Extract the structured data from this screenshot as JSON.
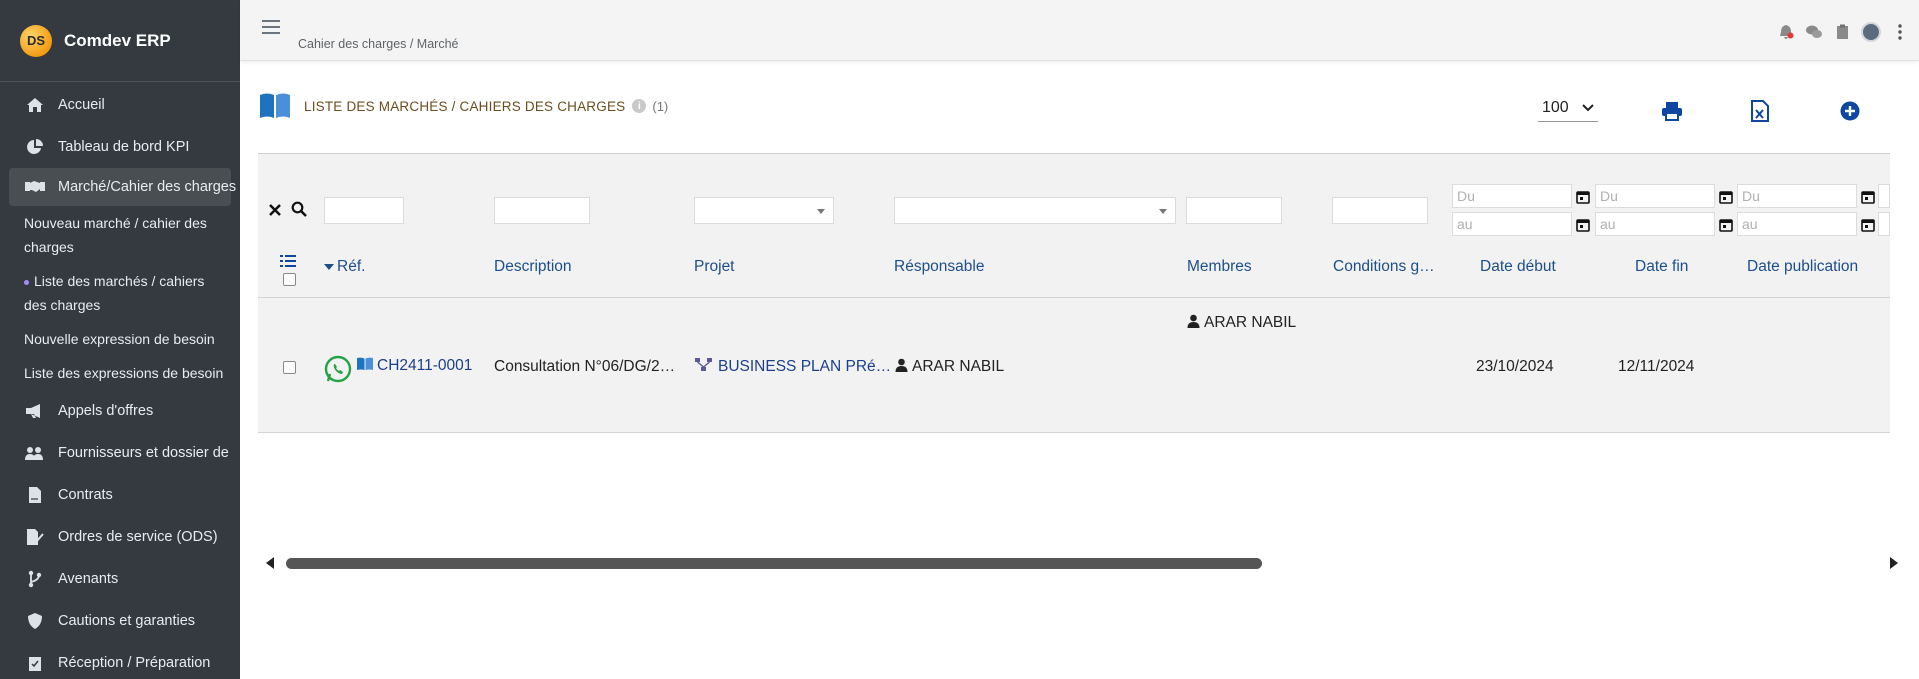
{
  "brand": {
    "logo_text": "DS",
    "name": "Comdev ERP"
  },
  "sidebar": {
    "items": [
      {
        "label": "Accueil",
        "icon": "home-icon"
      },
      {
        "label": "Tableau de bord KPI",
        "icon": "pie-chart-icon"
      },
      {
        "label": "Marché/Cahier des charges",
        "icon": "handshake-icon",
        "active": true
      },
      {
        "label": "Appels d'offres",
        "icon": "megaphone-icon"
      },
      {
        "label": "Fournisseurs et dossier de",
        "icon": "users-gear-icon"
      },
      {
        "label": "Contrats",
        "icon": "file-contract-icon"
      },
      {
        "label": "Ordres de service (ODS)",
        "icon": "file-signature-icon"
      },
      {
        "label": "Avenants",
        "icon": "branch-icon"
      },
      {
        "label": "Cautions et garanties",
        "icon": "shield-icon"
      },
      {
        "label": "Réception / Préparation",
        "icon": "clipboard-check-icon"
      }
    ],
    "sub_items": [
      {
        "label": "Nouveau marché / cahier des charges"
      },
      {
        "label": "Liste des marchés / cahiers des charges",
        "current": true
      },
      {
        "label": "Nouvelle expression de besoin"
      },
      {
        "label": "Liste des expressions de besoin"
      }
    ]
  },
  "topbar": {
    "breadcrumb": "Cahier des charges / Marché"
  },
  "page": {
    "title": "LISTE DES MARCHÉS / CAHIERS DES CHARGES",
    "info_icon": "i",
    "count": "(1)",
    "page_size": "100"
  },
  "filters": {
    "date_from_placeholder": "Du",
    "date_to_placeholder": "au"
  },
  "table": {
    "columns": {
      "ref": "Réf.",
      "description": "Description",
      "projet": "Projet",
      "responsable": "Résponsable",
      "membres": "Membres",
      "conditions": "Conditions g…",
      "date_debut": "Date début",
      "date_fin": "Date fin",
      "date_publication": "Date publication"
    },
    "rows": [
      {
        "ref": "CH2411-0001",
        "description": "Consultation N°06/DG/2…",
        "projet": "BUSINESS PLAN PRé…",
        "responsable": "ARAR NABIL",
        "membres": "ARAR NABIL",
        "date_debut": "23/10/2024",
        "date_fin": "12/11/2024",
        "date_publication": ""
      }
    ]
  },
  "colors": {
    "sidebar_bg": "#343a40",
    "link": "#1c3f8a",
    "header_text": "#1c4f8a",
    "whatsapp": "#25a244",
    "primary_icon": "#0d47a1"
  }
}
